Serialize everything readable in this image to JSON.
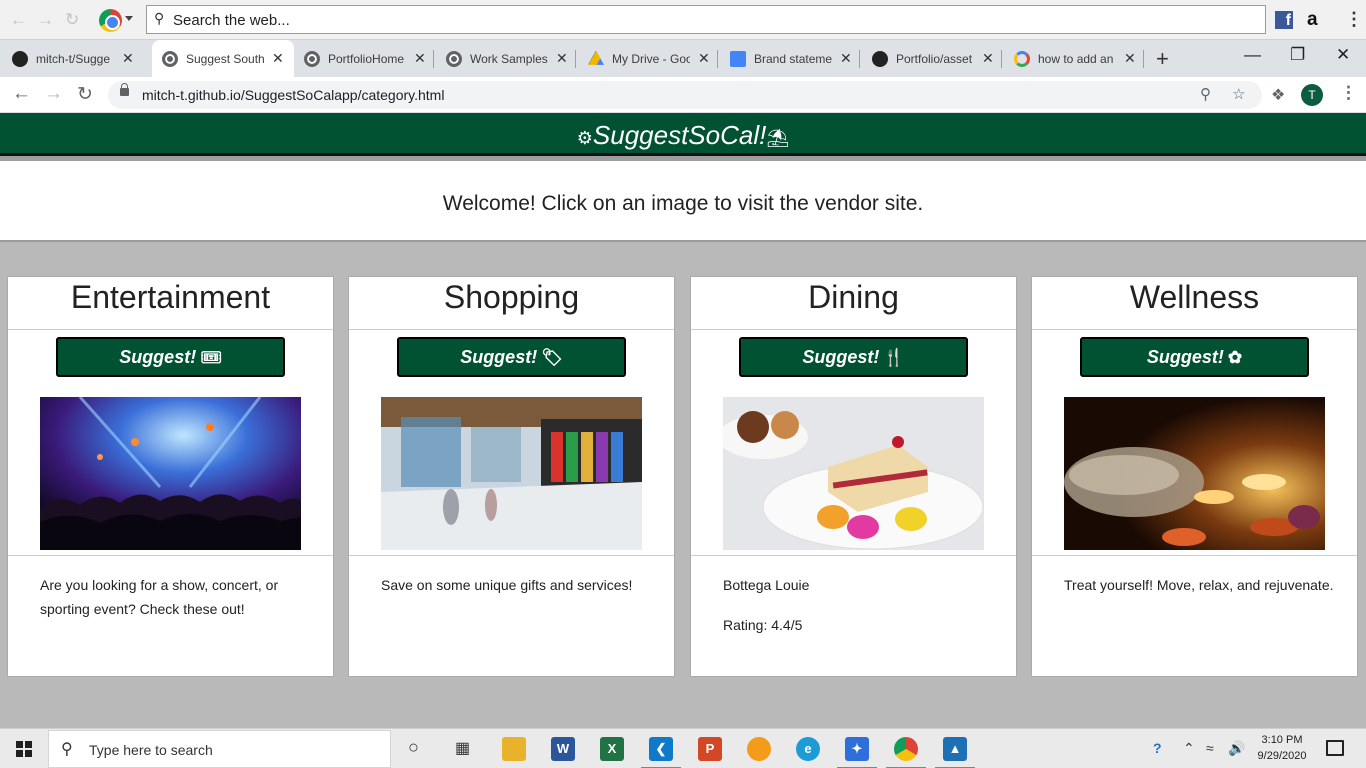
{
  "toolbar": {
    "search_placeholder": "Search the web..."
  },
  "tabs": [
    {
      "title": "mitch-t/Sugge",
      "favicon": "github-icon"
    },
    {
      "title": "Suggest South",
      "favicon": "globe-icon",
      "active": true
    },
    {
      "title": "PortfolioHome",
      "favicon": "globe-icon"
    },
    {
      "title": "Work Samples",
      "favicon": "globe-icon"
    },
    {
      "title": "My Drive - Goo",
      "favicon": "google-drive-icon"
    },
    {
      "title": "Brand stateme",
      "favicon": "google-docs-icon"
    },
    {
      "title": "Portfolio/asset",
      "favicon": "github-icon"
    },
    {
      "title": "how to add an",
      "favicon": "google-icon"
    }
  ],
  "address": {
    "url": "mitch-t.github.io/SuggestSoCalapp/category.html"
  },
  "profile_initial": "T",
  "site": {
    "brand": "SuggestSoCal!",
    "welcome": "Welcome! Click on an image to visit the vendor site."
  },
  "cards": [
    {
      "title": "Entertainment",
      "button": "Suggest!",
      "button_icon": "ticket-icon",
      "lines": [
        "Are you looking for a show, concert, or sporting event? Check these out!"
      ]
    },
    {
      "title": "Shopping",
      "button": "Suggest!",
      "button_icon": "tag-icon",
      "lines": [
        "Save on some unique gifts and services!"
      ]
    },
    {
      "title": "Dining",
      "button": "Suggest!",
      "button_icon": "utensils-icon",
      "lines": [
        "Bottega Louie",
        "Rating: 4.4/5"
      ]
    },
    {
      "title": "Wellness",
      "button": "Suggest!",
      "button_icon": "spa-icon",
      "lines": [
        "Treat yourself! Move, relax, and rejuvenate."
      ]
    }
  ],
  "taskbar": {
    "search_placeholder": "Type here to search",
    "time": "3:10 PM",
    "date": "9/29/2020"
  },
  "colors": {
    "brand_green": "#005232",
    "page_bg": "#b9b9b9"
  }
}
